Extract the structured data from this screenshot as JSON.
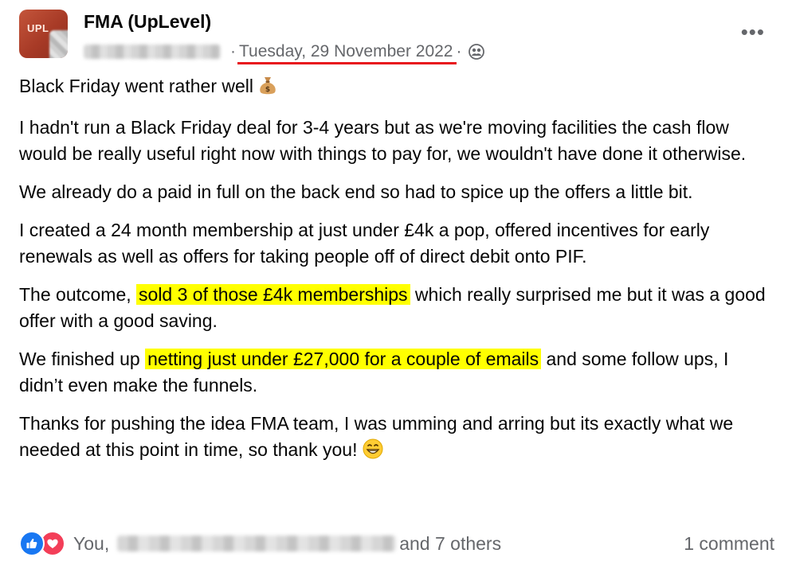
{
  "post": {
    "group_name": "FMA (UpLevel)",
    "avatar_text": "UPL",
    "meta": {
      "separator": "·",
      "date": "Tuesday, 29 November 2022",
      "audience_icon": "group-icon"
    },
    "more_icon": "•••",
    "paragraphs": {
      "p1": "Black Friday went rather well",
      "p1_emoji": "money-bag-emoji",
      "p2": "I hadn't run a Black Friday deal for 3-4 years but as we're moving facilities the cash flow would be really useful right now with things to pay for, we wouldn't have done it otherwise.",
      "p3": "We already do a paid in full on the back end so had to spice up the offers a little bit.",
      "p4": "I created a 24 month membership at just under £4k a pop, offered incentives for early renewals as well as offers for taking people off of direct debit onto PIF.",
      "p5_before": "The outcome, ",
      "p5_highlight": "sold 3 of those £4k memberships",
      "p5_after": " which really surprised me but it was a good offer with a good saving.",
      "p6_before": "We finished up ",
      "p6_highlight": "netting just under £27,000 for a couple of emails",
      "p6_after": " and some follow ups, I didn’t even make the funnels.",
      "p7": "Thanks for pushing the idea FMA team, I was umming and arring but its exactly what we needed at this point in time, so thank you!",
      "p7_emoji": "grinning-face-emoji"
    },
    "footer": {
      "reactions_you": "You,",
      "reactions_others": "and 7 others",
      "comment_count": "1 comment"
    },
    "colors": {
      "highlight": "#ffff00",
      "date_underline": "#e8161d",
      "like_blue": "#1877f2",
      "love_red": "#f33e58",
      "secondary_text": "#65676b"
    }
  }
}
